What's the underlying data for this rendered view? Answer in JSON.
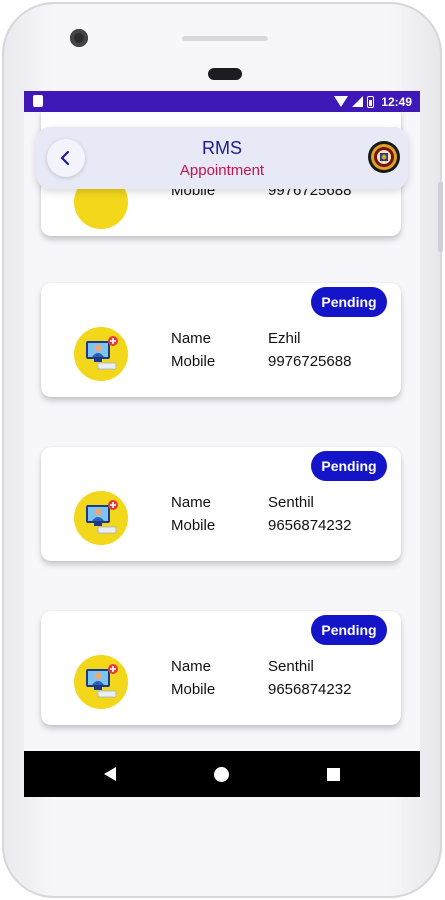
{
  "status_bar": {
    "time": "12:49"
  },
  "header": {
    "title": "RMS",
    "subtitle": "Appointment"
  },
  "partial_card": {
    "label": "Mobile",
    "value": "9976725688"
  },
  "cards": [
    {
      "status": "Pending",
      "name_label": "Name",
      "name": "Ezhil",
      "mobile_label": "Mobile",
      "mobile": "9976725688"
    },
    {
      "status": "Pending",
      "name_label": "Name",
      "name": "Senthil",
      "mobile_label": "Mobile",
      "mobile": "9656874232"
    },
    {
      "status": "Pending",
      "name_label": "Name",
      "name": "Senthil",
      "mobile_label": "Mobile",
      "mobile": "9656874232"
    }
  ],
  "colors": {
    "status_bar": "#3f19b8",
    "badge": "#1414c8",
    "title": "#1d1d8f",
    "subtitle": "#c4124d",
    "avatar": "#f3d71a"
  },
  "icons": {
    "back": "chevron-left-icon",
    "logo": "emblem-icon",
    "avatar": "doctor-consult-icon"
  }
}
